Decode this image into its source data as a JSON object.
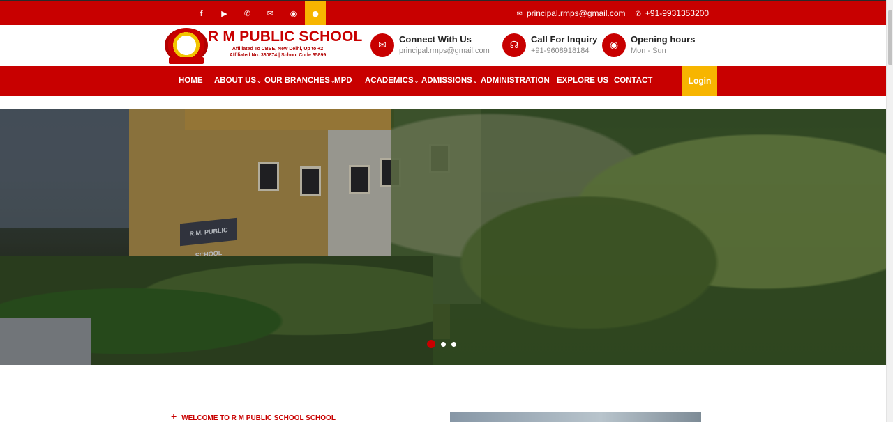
{
  "topbar": {
    "social_icons": [
      "facebook-icon",
      "youtube-icon",
      "phone-icon",
      "mail-icon",
      "whatsapp-icon",
      "user-icon"
    ],
    "email": "principal.rmps@gmail.com",
    "phone": "+91-9931353200"
  },
  "header": {
    "school_name": "R M PUBLIC SCHOOL",
    "affiliation_line1": "Affiliated To CBSE, New Delhi, Up to +2",
    "affiliation_line2": "Affiliated No. 330874 | School Code 65899",
    "connect": {
      "title": "Connect With Us",
      "value": "principal.rmps@gmail.com"
    },
    "inquiry": {
      "title": "Call For Inquiry",
      "value": "+91-9608918184"
    },
    "hours": {
      "title": "Opening hours",
      "value": "Mon - Sun"
    }
  },
  "nav": {
    "items": [
      "HOME",
      "ABOUT US",
      "OUR BRANCHES",
      "MPD",
      "ACADEMICS",
      "ADMISSIONS",
      "ADMINISTRATION",
      "EXPLORE US",
      "CONTACT"
    ],
    "login": "Login"
  },
  "hero": {
    "sign_text": "R.M. PUBLIC SCHOOL",
    "slide_count": 3,
    "active_slide": 1
  },
  "intro": {
    "welcome": "WELCOME TO R M PUBLIC SCHOOL SCHOOL"
  },
  "colors": {
    "primary": "#c80000",
    "accent": "#f7b500"
  }
}
